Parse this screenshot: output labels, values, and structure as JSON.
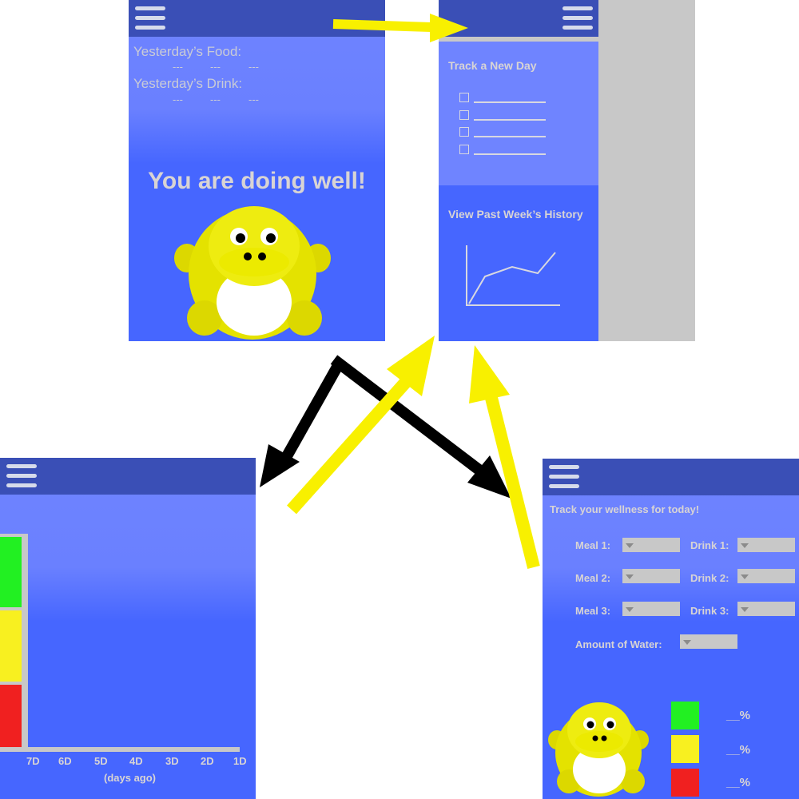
{
  "home": {
    "food_label": "Yesterday’s Food:",
    "drink_label": "Yesterday’s Drink:",
    "food_values": [
      "---",
      "---",
      "---"
    ],
    "drink_values": [
      "---",
      "---",
      "---"
    ],
    "status_message": "You are doing well!"
  },
  "menu": {
    "track_new_day": "Track a New Day",
    "view_history": "View Past Week’s History"
  },
  "history": {
    "x_ticks": [
      "7D",
      "6D",
      "5D",
      "4D",
      "3D",
      "2D",
      "1D"
    ],
    "x_label": "(days ago)"
  },
  "tracker": {
    "heading": "Track your wellness for today!",
    "meal1": "Meal 1:",
    "meal2": "Meal 2:",
    "meal3": "Meal 3:",
    "drink1": "Drink 1:",
    "drink2": "Drink 2:",
    "drink3": "Drink 3:",
    "water": "Amount of Water:",
    "pct_green": "__%",
    "pct_yellow": "__%",
    "pct_red": "__%"
  },
  "colors": {
    "header": "#3a4fb6",
    "screen_blue": "#4666ff",
    "screen_light": "#6f84ff",
    "status_green": "#22f022",
    "status_yellow": "#f8f020",
    "status_red": "#f02020",
    "arrow_yellow": "#f8f000",
    "arrow_black": "#000000",
    "pet_yellow": "#e4e200"
  },
  "icons": [
    "hamburger-menu-icon",
    "pet-mascot-icon",
    "checkbox-icon",
    "line-chart-icon",
    "dropdown-arrow-icon"
  ]
}
